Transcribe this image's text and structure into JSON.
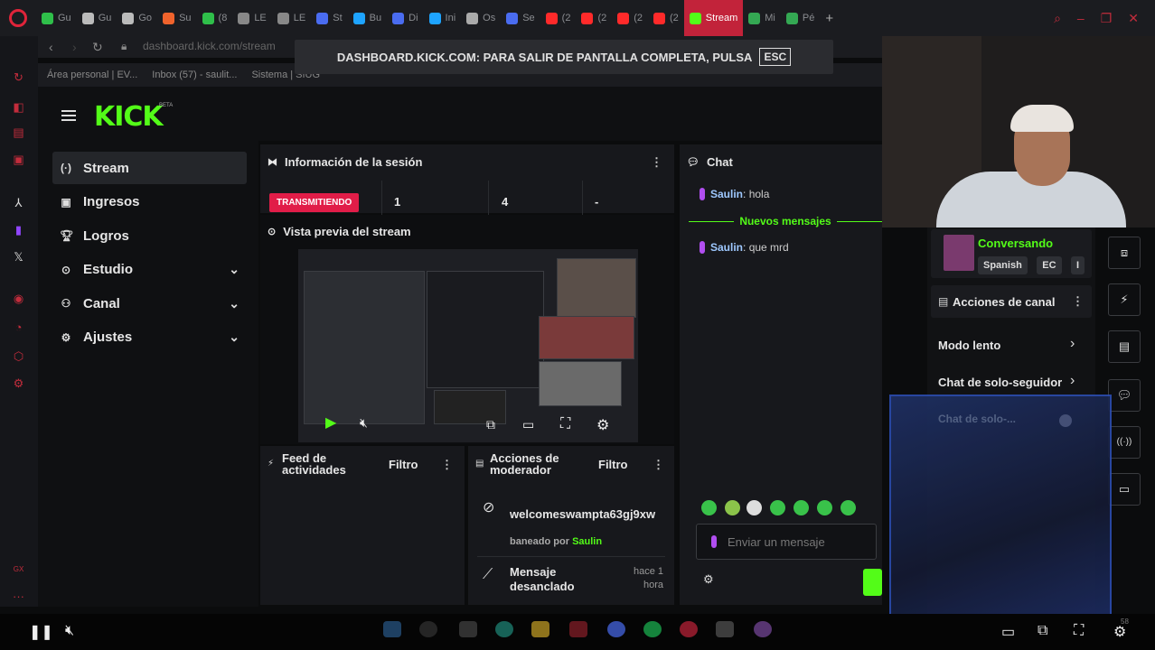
{
  "browser": {
    "tabs": [
      {
        "label": "Gu",
        "icon": "whatsapp-icon",
        "color": "#2fbf4a"
      },
      {
        "label": "Gu",
        "icon": "chatgpt-icon",
        "color": "#bbbbbb"
      },
      {
        "label": "Go",
        "icon": "page-icon",
        "color": "#bbbbbb"
      },
      {
        "label": "Su",
        "icon": "app-icon",
        "color": "#f0632c"
      },
      {
        "label": "(8",
        "icon": "whatsapp-icon",
        "color": "#2fbf4a"
      },
      {
        "label": "LE",
        "icon": "doc-icon",
        "color": "#888888"
      },
      {
        "label": "LE",
        "icon": "doc-icon",
        "color": "#888888"
      },
      {
        "label": "St",
        "icon": "app-icon",
        "color": "#4a6cf0"
      },
      {
        "label": "Bu",
        "icon": "app-icon",
        "color": "#1ea4ff"
      },
      {
        "label": "Di",
        "icon": "app-icon",
        "color": "#4a6cf0"
      },
      {
        "label": "Ini",
        "icon": "app-icon",
        "color": "#1ea4ff"
      },
      {
        "label": "Os",
        "icon": "app-icon",
        "color": "#aaaaaa"
      },
      {
        "label": "Se",
        "icon": "app-icon",
        "color": "#4a6cf0"
      },
      {
        "label": "(2",
        "icon": "youtube-icon",
        "color": "#ff2a2a"
      },
      {
        "label": "(2",
        "icon": "youtube-icon",
        "color": "#ff2a2a"
      },
      {
        "label": "(2",
        "icon": "youtube-icon",
        "color": "#ff2a2a"
      },
      {
        "label": "(2",
        "icon": "youtube-icon",
        "color": "#ff2a2a"
      },
      {
        "label": "Stream",
        "icon": "kick-icon",
        "color": "#53fc18",
        "active": true
      },
      {
        "label": "Mi",
        "icon": "drive-icon",
        "color": "#34a853"
      },
      {
        "label": "Pé",
        "icon": "drive-icon",
        "color": "#34a853"
      }
    ],
    "url": "dashboard.kick.com/stream",
    "fullscreen_notice": "DASHBOARD.KICK.COM: PARA SALIR DE PANTALLA COMPLETA, PULSA",
    "esc_key": "ESC",
    "bookmarks": [
      "Área personal | EV...",
      "Inbox (57) - saulit...",
      "Sistema | SIUG"
    ]
  },
  "kick": {
    "logo": "KICK",
    "logo_badge": "BETA",
    "nav": [
      {
        "label": "Stream",
        "icon": "stream-icon",
        "active": true
      },
      {
        "label": "Ingresos",
        "icon": "income-icon"
      },
      {
        "label": "Logros",
        "icon": "trophy-icon"
      },
      {
        "label": "Estudio",
        "icon": "studio-icon",
        "expandable": true
      },
      {
        "label": "Canal",
        "icon": "channel-icon",
        "expandable": true
      },
      {
        "label": "Ajustes",
        "icon": "gear-icon",
        "expandable": true
      }
    ],
    "session": {
      "title": "Información de la sesión",
      "status": "TRANSMITIENDO",
      "stats": [
        "1",
        "4",
        "-"
      ]
    },
    "preview": {
      "title": "Vista previa del stream"
    },
    "feed": {
      "title": "Feed de actividades",
      "filter": "Filtro"
    },
    "mod": {
      "title": "Acciones de moderador",
      "filter": "Filtro",
      "entries": [
        {
          "user": "welcomeswampta63gj9xw",
          "action_prefix": "baneado por",
          "by": "Saulin"
        },
        {
          "action": "Mensaje desanclado",
          "time": "hace 1 hora"
        }
      ]
    },
    "chat": {
      "title": "Chat",
      "messages": [
        {
          "user": "Saulin",
          "text": "hola"
        },
        {
          "user": "Saulin",
          "text": "que mrd"
        }
      ],
      "new_messages": "Nuevos mensajes",
      "input_placeholder": "Enviar un mensaje"
    },
    "right_panel": {
      "category": "Conversando",
      "tags": [
        "Spanish",
        "EC",
        "I"
      ],
      "actions_title": "Acciones de canal",
      "actions": [
        "Modo lento",
        "Chat de solo-seguidor",
        "Chat de solo-..."
      ]
    }
  },
  "bottom_bar": {
    "timestamp": "58"
  }
}
